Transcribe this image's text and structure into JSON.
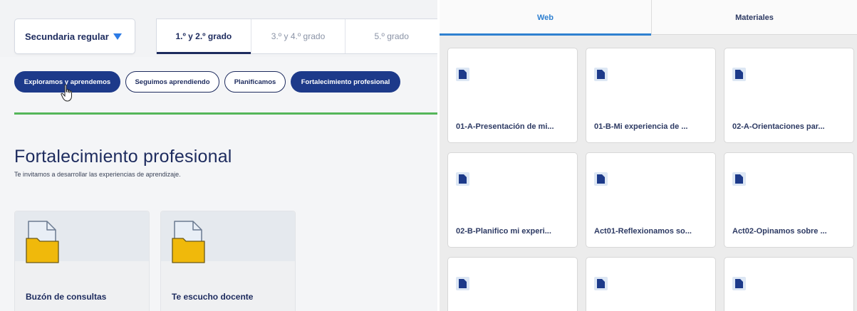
{
  "left": {
    "level_select": {
      "value": "Secundaria regular"
    },
    "grade_tabs": [
      {
        "label": "1.º y 2.º grado",
        "active": true
      },
      {
        "label": "3.º y 4.º grado",
        "active": false
      },
      {
        "label": "5.º grado",
        "active": false
      }
    ],
    "pills": [
      {
        "label": "Exploramos y aprendemos",
        "active": true
      },
      {
        "label": "Seguimos aprendiendo",
        "active": false
      },
      {
        "label": "Planificamos",
        "active": false
      },
      {
        "label": "Fortalecimiento profesional",
        "active": true
      }
    ],
    "section": {
      "title": "Fortalecimiento profesional",
      "subtitle": "Te invitamos a desarrollar las experiencias de aprendizaje."
    },
    "cards": [
      {
        "title": "Buzón de consultas",
        "icon": "folder-icon"
      },
      {
        "title": "Te escucho docente",
        "icon": "folder-icon"
      }
    ]
  },
  "right": {
    "tabs": [
      {
        "label": "Web",
        "active": true
      },
      {
        "label": "Materiales",
        "active": false
      }
    ],
    "files": [
      {
        "name": "01-A-Presentación de mi...",
        "icon": "document-icon"
      },
      {
        "name": "01-B-Mi experiencia de ...",
        "icon": "document-icon"
      },
      {
        "name": "02-A-Orientaciones par...",
        "icon": "document-icon"
      },
      {
        "name": "02-B-Planifico mi experi...",
        "icon": "document-icon"
      },
      {
        "name": "Act01-Reflexionamos so...",
        "icon": "document-icon"
      },
      {
        "name": "Act02-Opinamos sobre ...",
        "icon": "document-icon"
      },
      {
        "name": "",
        "icon": "document-icon"
      },
      {
        "name": "",
        "icon": "document-icon"
      },
      {
        "name": "",
        "icon": "document-icon"
      }
    ]
  },
  "colors": {
    "navy": "#1d2b5e",
    "pill_dark": "#1d3a8a",
    "green_accent": "#55b65a",
    "web_tab_blue": "#2f80d0",
    "folder_yellow": "#f0b90b"
  }
}
